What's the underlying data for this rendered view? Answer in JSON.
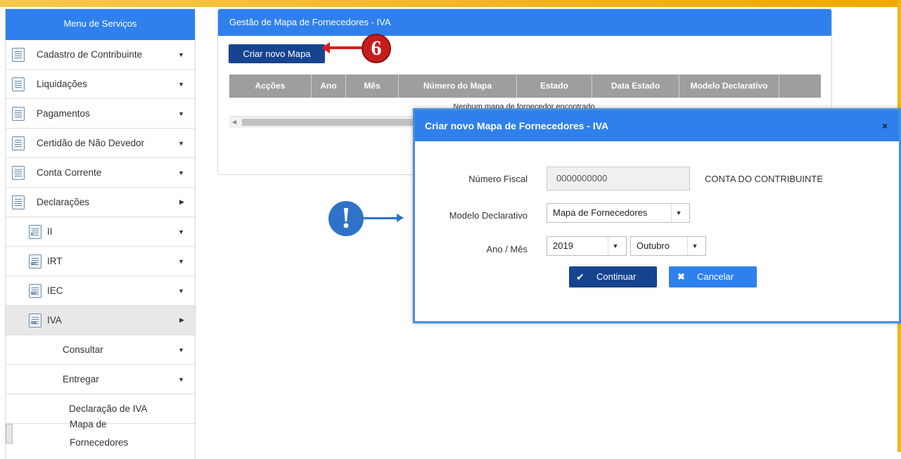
{
  "sidebar": {
    "title": "Menu de Serviços",
    "items": [
      {
        "label": "Cadastro de Contribuinte",
        "arrow": "▼"
      },
      {
        "label": "Liquidações",
        "arrow": "▼"
      },
      {
        "label": "Pagamentos",
        "arrow": "▼"
      },
      {
        "label": "Certidão de Não Devedor",
        "arrow": "▼"
      },
      {
        "label": "Conta Corrente",
        "arrow": "▼"
      },
      {
        "label": "Declarações",
        "arrow": "▶"
      },
      {
        "label": "II",
        "arrow": "▼",
        "icon_text": "II"
      },
      {
        "label": "IRT",
        "arrow": "▼",
        "icon_text": "IRT"
      },
      {
        "label": "IEC",
        "arrow": "▼",
        "icon_text": "IEC"
      },
      {
        "label": "IVA",
        "arrow": "▶",
        "icon_text": "IVA"
      },
      {
        "label": "Consultar",
        "arrow": "▼"
      },
      {
        "label": "Entregar",
        "arrow": "▼"
      },
      {
        "label": "Declaração de IVA"
      },
      {
        "label": "Mapa de Fornecedores"
      }
    ]
  },
  "panel": {
    "title": "Gestão de Mapa de Fornecedores - IVA",
    "new_button": "Criar novo Mapa",
    "columns": [
      "Acções",
      "Ano",
      "Mês",
      "Número do Mapa",
      "Estado",
      "Data Estado",
      "Modelo Declarativo"
    ],
    "empty_message": "Nenhum mapa de fornecedor encontrado."
  },
  "annotations": {
    "step": "6",
    "attention": "!"
  },
  "modal": {
    "title": "Criar novo Mapa de Fornecedores - IVA",
    "close": "×",
    "nif_label": "Número Fiscal",
    "nif_value": "0000000000",
    "account_label": "CONTA DO CONTRIBUINTE",
    "model_label": "Modelo Declarativo",
    "model_value": "Mapa de Fornecedores",
    "period_label": "Ano / Mês",
    "year_value": "2019",
    "month_value": "Outubro",
    "continue_label": "Continuar",
    "cancel_label": "Cancelar"
  },
  "colors": {
    "accent": "#2f80ed",
    "dark_button": "#16448f",
    "top_bar": "#f3b320",
    "annotation_red": "#c51d1d"
  }
}
